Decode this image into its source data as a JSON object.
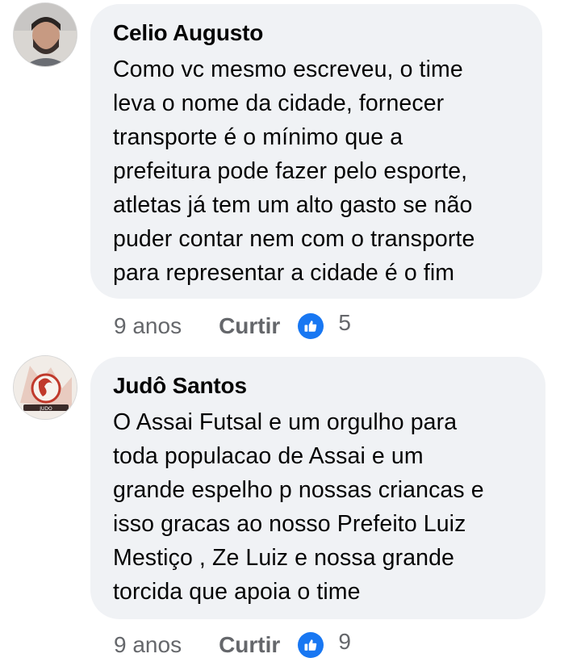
{
  "comments": [
    {
      "author": "Celio Augusto",
      "text": "Como vc mesmo escreveu, o time\nleva o nome da cidade, fornecer\ntransporte é o mínimo que a\nprefeitura pode fazer pelo esporte,\natletas já tem um alto gasto se não\npuder contar nem com o transporte\npara representar a cidade é o fim",
      "time": "9 anos",
      "like_label": "Curtir",
      "reaction_icon": "like-icon",
      "reaction_count": "5",
      "avatar": "user-photo-avatar"
    },
    {
      "author": "Judô Santos",
      "text": "O Assai Futsal e um orgulho para\ntoda populacao de Assai e um\ngrande espelho p nossas criancas e\nisso gracas ao nosso Prefeito Luiz\nMestiço , Ze Luiz e nossa grande\ntorcida que apoia o time",
      "time": "9 anos",
      "like_label": "Curtir",
      "reaction_icon": "like-icon",
      "reaction_count": "9",
      "avatar": "judo-logo-avatar",
      "avatar_logo_text": "JUDO"
    }
  ],
  "colors": {
    "bubble": "#f0f2f5",
    "meta_text": "#65676b",
    "like_blue": "#1877f2"
  }
}
